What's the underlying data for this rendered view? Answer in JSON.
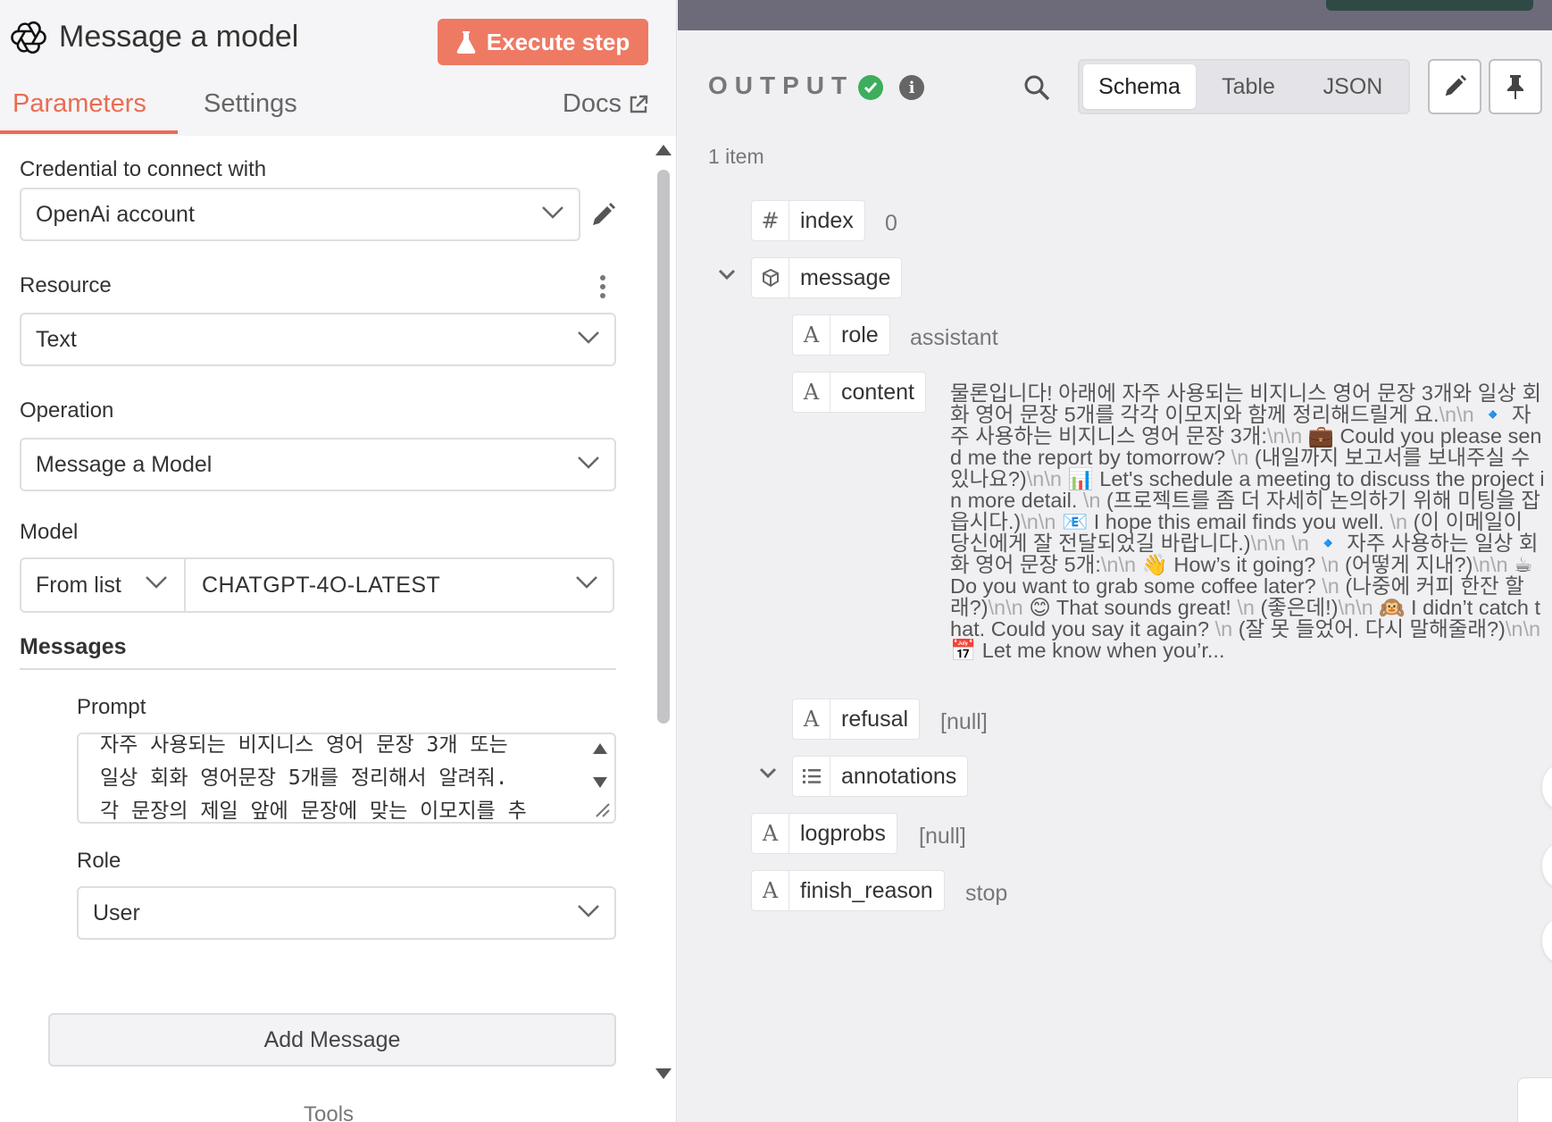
{
  "node": {
    "title": "Message a model",
    "execute_label": "Execute step"
  },
  "tabs": {
    "parameters": "Parameters",
    "settings": "Settings",
    "docs": "Docs"
  },
  "params": {
    "credential": {
      "label": "Credential to connect with",
      "value": "OpenAi account"
    },
    "resource": {
      "label": "Resource",
      "value": "Text"
    },
    "operation": {
      "label": "Operation",
      "value": "Message a Model"
    },
    "model": {
      "label": "Model",
      "mode": "From list",
      "value": "CHATGPT-4O-LATEST"
    },
    "messages": {
      "title": "Messages",
      "prompt_label": "Prompt",
      "prompt_text": "자주 사용되는 비지니스 영어 문장 3개 또는\n일상 회화 영어문장 5개를 정리해서 알려줘.\n각 문장의 제일 앞에 문장에 맞는 이모지를 추",
      "role_label": "Role",
      "role_value": "User",
      "add_label": "Add Message"
    },
    "tools_label": "Tools"
  },
  "output": {
    "label": "OUTPUT",
    "view_tabs": [
      "Schema",
      "Table",
      "JSON"
    ],
    "active_view": "Schema",
    "item_count": "1 item",
    "fields": {
      "index": {
        "type_icon": "#",
        "name": "index",
        "value": "0"
      },
      "message": {
        "name": "message"
      },
      "role": {
        "type_icon": "A",
        "name": "role",
        "value": "assistant"
      },
      "content": {
        "type_icon": "A",
        "name": "content",
        "segments": [
          {
            "t": "물론입니다! 아래에 자주 사용되는 비지니스 영어 문장 3개와 일상 회화 영어 문장 5개를 각각 이모지와 함께 정리해드릴게 요."
          },
          {
            "t": "\\n\\n",
            "esc": true
          },
          {
            "t": " 🔹 자주 사용하는 비지니스 영어 문장 3개:"
          },
          {
            "t": "\\n\\n",
            "esc": true
          },
          {
            "t": " 💼 Could you please send me the report by tomorrow? "
          },
          {
            "t": "\\n",
            "esc": true
          },
          {
            "t": " (내일까지 보고서를 보내주실 수 있나요?)"
          },
          {
            "t": "\\n\\n",
            "esc": true
          },
          {
            "t": " 📊 Let's schedule a meeting to discuss the project in more detail. "
          },
          {
            "t": "\\n",
            "esc": true
          },
          {
            "t": " (프로젝트를 좀 더 자세히 논의하기 위해 미팅을 잡읍시다.)"
          },
          {
            "t": "\\n\\n",
            "esc": true
          },
          {
            "t": " 📧 I hope this email finds you well. "
          },
          {
            "t": "\\n",
            "esc": true
          },
          {
            "t": " (이 이메일이 당신에게 잘 전달되었길 바랍니다.)"
          },
          {
            "t": "\\n\\n",
            "esc": true
          },
          {
            "t": "    "
          },
          {
            "t": "\\n",
            "esc": true
          },
          {
            "t": " 🔹 자주 사용하는 일상 회화 영어 문장 5개:"
          },
          {
            "t": "\\n\\n",
            "esc": true
          },
          {
            "t": " 👋 How’s it going? "
          },
          {
            "t": "\\n",
            "esc": true
          },
          {
            "t": " (어떻게 지내?)"
          },
          {
            "t": "\\n\\n",
            "esc": true
          },
          {
            "t": " ☕ Do you want to grab some coffee later? "
          },
          {
            "t": "\\n",
            "esc": true
          },
          {
            "t": " (나중에 커피 한잔 할래?)"
          },
          {
            "t": "\\n\\n",
            "esc": true
          },
          {
            "t": " 😊 That sounds great! "
          },
          {
            "t": "\\n",
            "esc": true
          },
          {
            "t": " (좋은데!)"
          },
          {
            "t": "\\n\\n",
            "esc": true
          },
          {
            "t": " 🙉 I didn’t catch that. Could you say it again? "
          },
          {
            "t": "\\n",
            "esc": true
          },
          {
            "t": " (잘 못 들었어. 다시 말해줄래?)"
          },
          {
            "t": "\\n\\n",
            "esc": true
          },
          {
            "t": " 📅 Let me know when you’r..."
          }
        ]
      },
      "refusal": {
        "type_icon": "A",
        "name": "refusal",
        "value": "[null]"
      },
      "annotations": {
        "name": "annotations"
      },
      "logprobs": {
        "type_icon": "A",
        "name": "logprobs",
        "value": "[null]"
      },
      "finish_reason": {
        "type_icon": "A",
        "name": "finish_reason",
        "value": "stop"
      }
    }
  },
  "colors": {
    "accent": "#ea6c53",
    "execute_bg": "#ee7a64",
    "success": "#3cae5c"
  }
}
